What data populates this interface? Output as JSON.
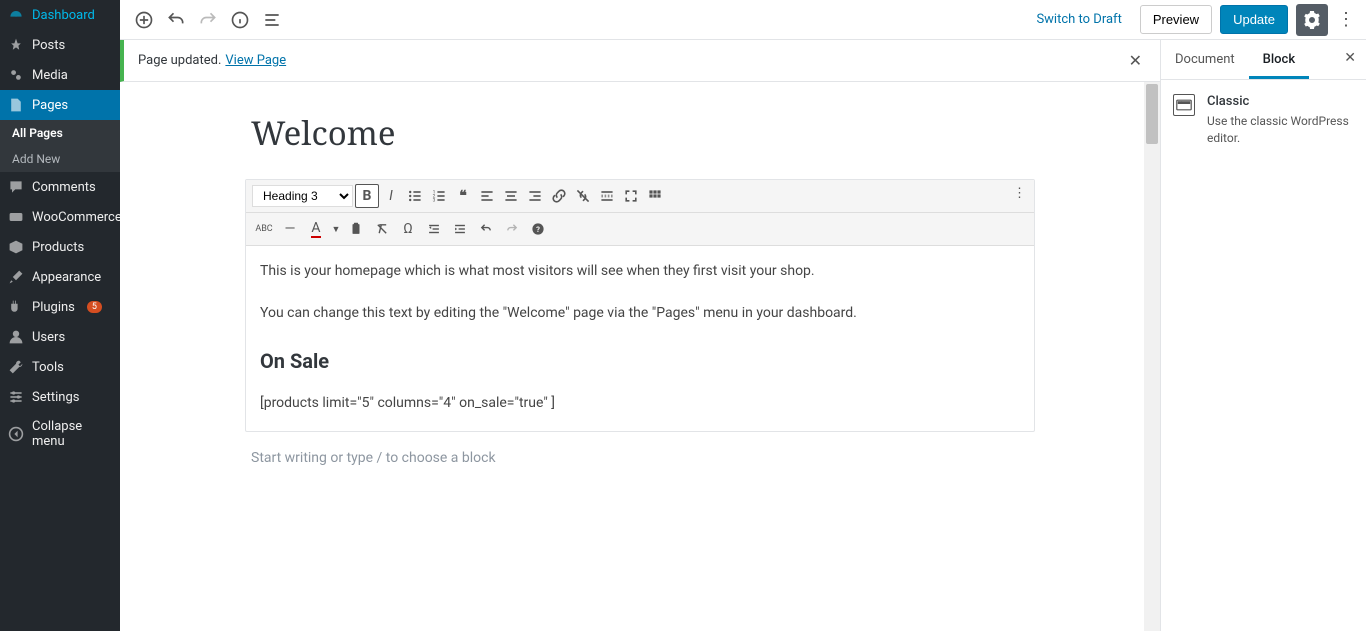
{
  "sidebar": {
    "items": [
      {
        "label": "Dashboard",
        "icon": "dashboard"
      },
      {
        "label": "Posts",
        "icon": "pin"
      },
      {
        "label": "Media",
        "icon": "media"
      },
      {
        "label": "Pages",
        "icon": "page",
        "active": true
      },
      {
        "label": "Comments",
        "icon": "comment"
      },
      {
        "label": "WooCommerce",
        "icon": "woo"
      },
      {
        "label": "Products",
        "icon": "product"
      },
      {
        "label": "Appearance",
        "icon": "brush"
      },
      {
        "label": "Plugins",
        "icon": "plugin",
        "badge": "5"
      },
      {
        "label": "Users",
        "icon": "user"
      },
      {
        "label": "Tools",
        "icon": "tool"
      },
      {
        "label": "Settings",
        "icon": "settings"
      },
      {
        "label": "Collapse menu",
        "icon": "collapse"
      }
    ],
    "submenu": [
      {
        "label": "All Pages",
        "current": true
      },
      {
        "label": "Add New"
      }
    ]
  },
  "toolbar": {
    "switch_draft": "Switch to Draft",
    "preview": "Preview",
    "update": "Update"
  },
  "notice": {
    "text": "Page updated.",
    "link": "View Page"
  },
  "editor": {
    "title": "Welcome",
    "format_select": "Heading 3",
    "content": {
      "p1": "This is your homepage which is what most visitors will see when they first visit your shop.",
      "p2": "You can change this text by editing the \"Welcome\" page via the \"Pages\" menu in your dashboard.",
      "h3": "On Sale",
      "p3": "[products limit=\"5\" columns=\"4\" on_sale=\"true\" ]"
    },
    "placeholder": "Start writing or type / to choose a block"
  },
  "settings": {
    "tabs": {
      "document": "Document",
      "block": "Block"
    },
    "block_name": "Classic",
    "block_desc": "Use the classic WordPress editor."
  }
}
